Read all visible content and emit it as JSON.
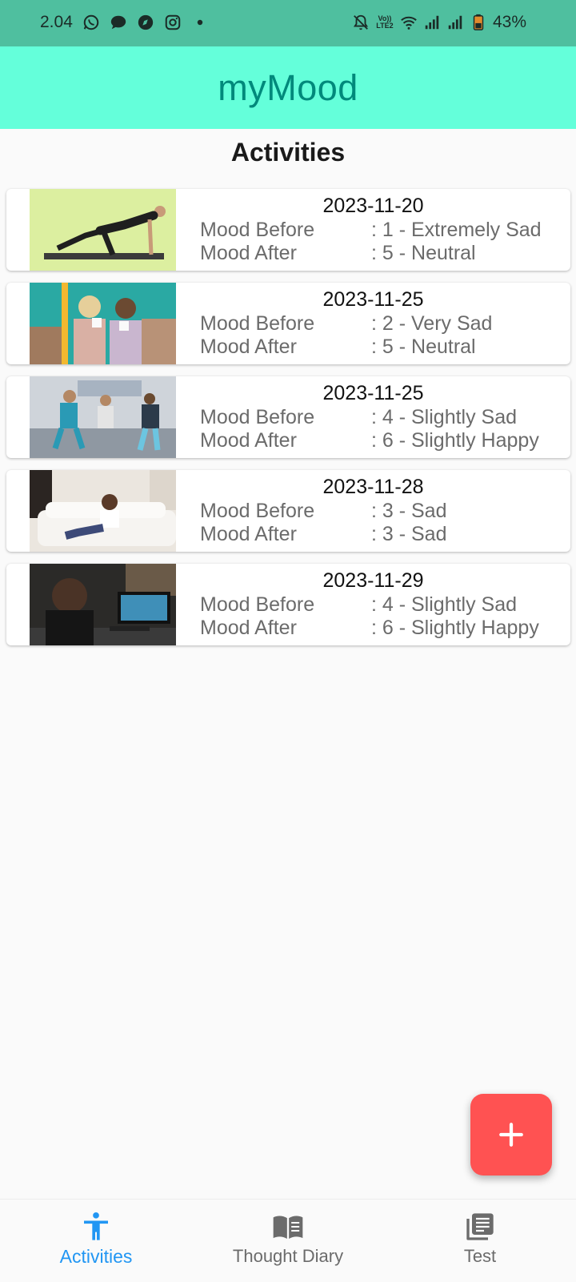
{
  "status_bar": {
    "time": "2.04",
    "network_label": "Vo)) LTE2",
    "battery": "43%",
    "icons": [
      "whatsapp-icon",
      "message-icon",
      "compass-icon",
      "instagram-icon",
      "dot-icon",
      "bell-off-icon",
      "wifi-icon",
      "signal-icon",
      "signal-icon",
      "battery-icon"
    ]
  },
  "app_bar": {
    "title": "myMood"
  },
  "page": {
    "section_title": "Activities"
  },
  "labels": {
    "mood_before": "Mood Before",
    "mood_after": "Mood After"
  },
  "activities": [
    {
      "date": "2023-11-20",
      "mood_before": ": 1 - Extremely Sad",
      "mood_after": ": 5 - Neutral",
      "image": "exercise-stretch-photo"
    },
    {
      "date": "2023-11-25",
      "mood_before": ": 2 - Very Sad",
      "mood_after": ": 5 - Neutral",
      "image": "two-women-drinking-tea-photo"
    },
    {
      "date": "2023-11-25",
      "mood_before": ": 4 - Slightly Sad",
      "mood_after": ": 6 - Slightly Happy",
      "image": "people-dancing-photo"
    },
    {
      "date": "2023-11-28",
      "mood_before": ": 3 - Sad",
      "mood_after": ": 3 - Sad",
      "image": "woman-on-sofa-photo"
    },
    {
      "date": "2023-11-29",
      "mood_before": ": 4 - Slightly Sad",
      "mood_after": ": 6 - Slightly Happy",
      "image": "gamer-at-computer-photo"
    }
  ],
  "fab": {
    "icon": "plus-icon",
    "color": "#ff5252"
  },
  "bottom_nav": [
    {
      "label": "Activities",
      "icon": "accessibility-icon",
      "active": true
    },
    {
      "label": "Thought Diary",
      "icon": "book-icon",
      "active": false
    },
    {
      "label": "Test",
      "icon": "library-books-icon",
      "active": false
    }
  ],
  "colors": {
    "status_bar": "#4fbf9f",
    "app_bar": "#64ffda",
    "title": "#00897b",
    "active_nav": "#2196f3",
    "inactive_nav": "#6b6b6b",
    "fab": "#ff5252"
  }
}
